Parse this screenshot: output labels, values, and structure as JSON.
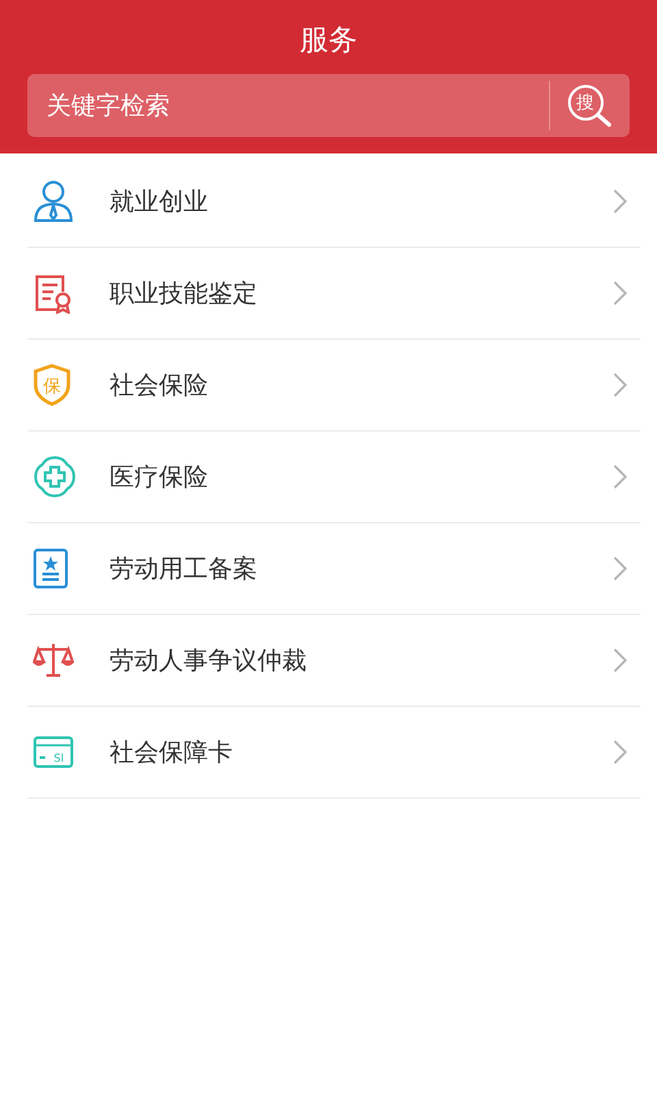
{
  "header": {
    "title": "服务"
  },
  "search": {
    "placeholder": "关键字检索",
    "button_label": "搜"
  },
  "services": [
    {
      "kind": "person",
      "label": "就业创业",
      "color": "#2a8fd6"
    },
    {
      "kind": "certificate",
      "label": "职业技能鉴定",
      "color": "#e0504f"
    },
    {
      "kind": "shield",
      "label": "社会保险",
      "color": "#f2a31b",
      "mark": "保"
    },
    {
      "kind": "cross",
      "label": "医疗保险",
      "color": "#2fc4b2"
    },
    {
      "kind": "document",
      "label": "劳动用工备案",
      "color": "#2a8fd6"
    },
    {
      "kind": "scale",
      "label": "劳动人事争议仲裁",
      "color": "#e0504f"
    },
    {
      "kind": "card",
      "label": "社会保障卡",
      "color": "#2fc4b2",
      "mark": "SI"
    }
  ]
}
